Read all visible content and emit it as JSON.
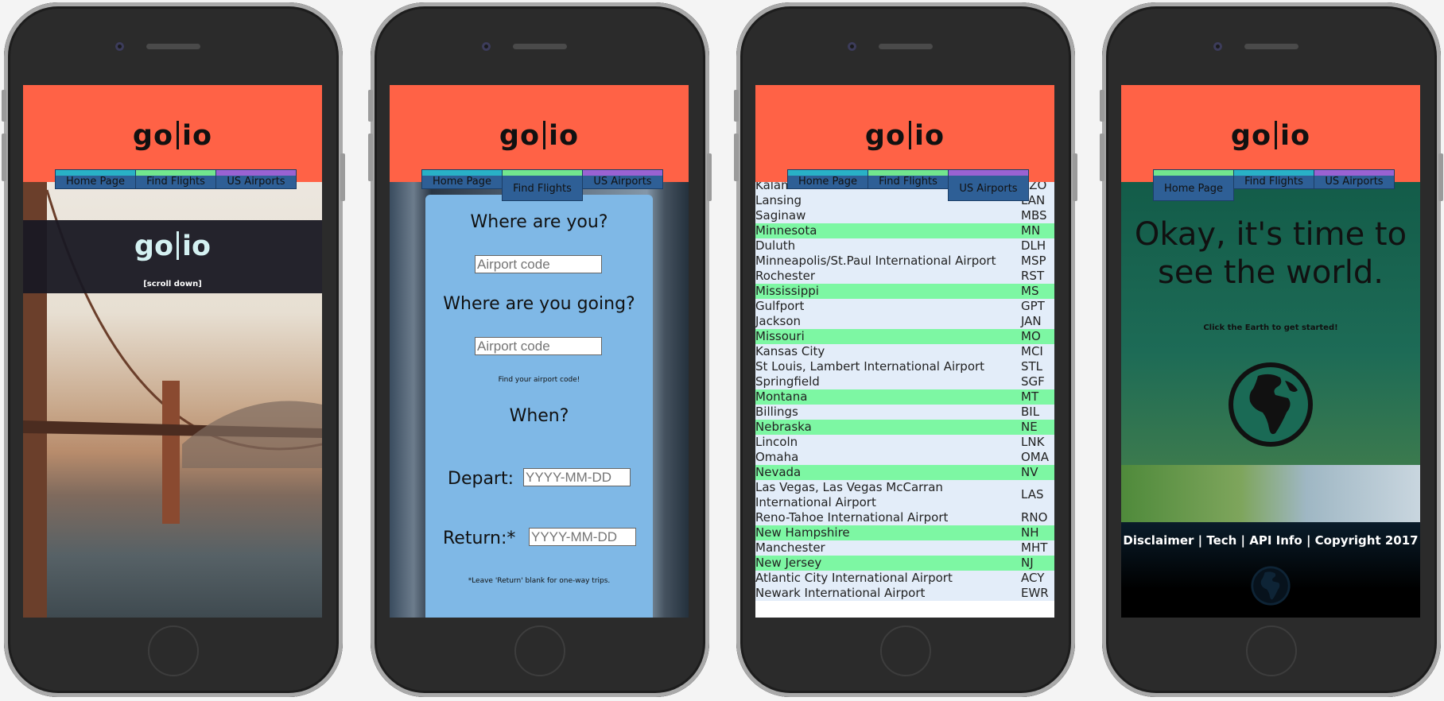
{
  "brand": {
    "logo_left": "go",
    "logo_right": "io"
  },
  "nav": {
    "home": "Home Page",
    "flights": "Find Flights",
    "airports": "US Airports"
  },
  "colors": {
    "header": "#ff6246",
    "nav_bg": "#2e5f96",
    "stripe_home": "#29b1c6",
    "stripe_flights": "#72e68e",
    "stripe_airports": "#9a62d2",
    "state_row": "#7df7a3"
  },
  "home": {
    "scroll_hint": "[scroll down]"
  },
  "search": {
    "where_from": "Where are you?",
    "from_placeholder": "Airport code",
    "where_to": "Where are you going?",
    "to_placeholder": "Airport code",
    "find_code": "Find your airport code!",
    "when": "When?",
    "depart_label": "Depart:",
    "depart_placeholder": "YYYY-MM-DD",
    "return_label": "Return:*",
    "return_placeholder": "YYYY-MM-DD",
    "note": "*Leave 'Return' blank for one-way trips."
  },
  "airports": {
    "rows": [
      {
        "name": "Kalamazoo-Battle Creek International Airport",
        "code": "AZO",
        "state": false
      },
      {
        "name": "Lansing",
        "code": "LAN",
        "state": false
      },
      {
        "name": "Saginaw",
        "code": "MBS",
        "state": false
      },
      {
        "name": "Minnesota",
        "code": "MN",
        "state": true
      },
      {
        "name": "Duluth",
        "code": "DLH",
        "state": false
      },
      {
        "name": "Minneapolis/St.Paul International Airport",
        "code": "MSP",
        "state": false
      },
      {
        "name": "Rochester",
        "code": "RST",
        "state": false
      },
      {
        "name": "Mississippi",
        "code": "MS",
        "state": true
      },
      {
        "name": "Gulfport",
        "code": "GPT",
        "state": false
      },
      {
        "name": "Jackson",
        "code": "JAN",
        "state": false
      },
      {
        "name": "Missouri",
        "code": "MO",
        "state": true
      },
      {
        "name": "Kansas City",
        "code": "MCI",
        "state": false
      },
      {
        "name": "St Louis, Lambert International Airport",
        "code": "STL",
        "state": false
      },
      {
        "name": "Springfield",
        "code": "SGF",
        "state": false
      },
      {
        "name": "Montana",
        "code": "MT",
        "state": true
      },
      {
        "name": "Billings",
        "code": "BIL",
        "state": false
      },
      {
        "name": "Nebraska",
        "code": "NE",
        "state": true
      },
      {
        "name": "Lincoln",
        "code": "LNK",
        "state": false
      },
      {
        "name": "Omaha",
        "code": "OMA",
        "state": false
      },
      {
        "name": "Nevada",
        "code": "NV",
        "state": true
      },
      {
        "name": "Las Vegas, Las Vegas McCarran International Airport",
        "code": "LAS",
        "state": false
      },
      {
        "name": "Reno-Tahoe International Airport",
        "code": "RNO",
        "state": false
      },
      {
        "name": "New Hampshire",
        "code": "NH",
        "state": true
      },
      {
        "name": "Manchester",
        "code": "MHT",
        "state": false
      },
      {
        "name": "New Jersey",
        "code": "NJ",
        "state": true
      },
      {
        "name": "Atlantic City International Airport",
        "code": "ACY",
        "state": false
      },
      {
        "name": "Newark International Airport",
        "code": "EWR",
        "state": false
      }
    ]
  },
  "explore": {
    "headline": "Okay, it's time to see the world.",
    "cta": "Click the Earth to get started!",
    "footer": "Disclaimer | Tech | API Info | Copyright 2017",
    "icon": "globe-icon"
  }
}
